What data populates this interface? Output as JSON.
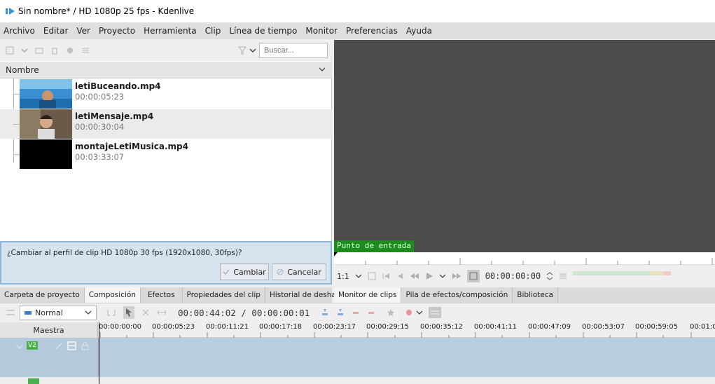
{
  "window": {
    "title": "Sin nombre* / HD 1080p 25 fps - Kdenlive"
  },
  "menu": [
    "Archivo",
    "Editar",
    "Ver",
    "Proyecto",
    "Herramienta",
    "Clip",
    "Línea de tiempo",
    "Monitor",
    "Preferencias",
    "Ayuda"
  ],
  "bin": {
    "search_placeholder": "Buscar...",
    "column_header": "Nombre",
    "clips": [
      {
        "name": "letiBuceando.mp4",
        "duration": "00:00:05:23"
      },
      {
        "name": "letiMensaje.mp4",
        "duration": "00:00:30:04"
      },
      {
        "name": "montajeLetiMusica.mp4",
        "duration": "00:03:33:07"
      }
    ]
  },
  "profile_prompt": {
    "question": "¿Cambiar al perfil de clip HD 1080p 30 fps (1920x1080, 30fps)?",
    "accept_label": "Cambiar",
    "cancel_label": "Cancelar"
  },
  "left_tabs": [
    "Carpeta de proyecto",
    "Composición",
    "Efectos",
    "Propiedades del clip",
    "Historial de deshacer"
  ],
  "monitor": {
    "marker_label": "Punto de entrada",
    "zoom": "1:1",
    "timecode": "00:00:00:00"
  },
  "right_tabs": [
    "Monitor de clips",
    "Pila de efectos/composición",
    "Biblioteca"
  ],
  "timeline": {
    "mode": "Normal",
    "timecode": "00:00:44:02 / 00:00:00:01",
    "master_label": "Maestra",
    "track_label": "V2",
    "ruler_ticks": [
      "00:00:00:00",
      "00:00:05:23",
      "00:00:11:21",
      "00:00:17:18",
      "00:00:23:17",
      "00:00:29:15",
      "00:00:35:12",
      "00:00:41:11",
      "00:00:47:09",
      "00:00:53:07",
      "00:00:59:05",
      "00:01:0"
    ]
  }
}
